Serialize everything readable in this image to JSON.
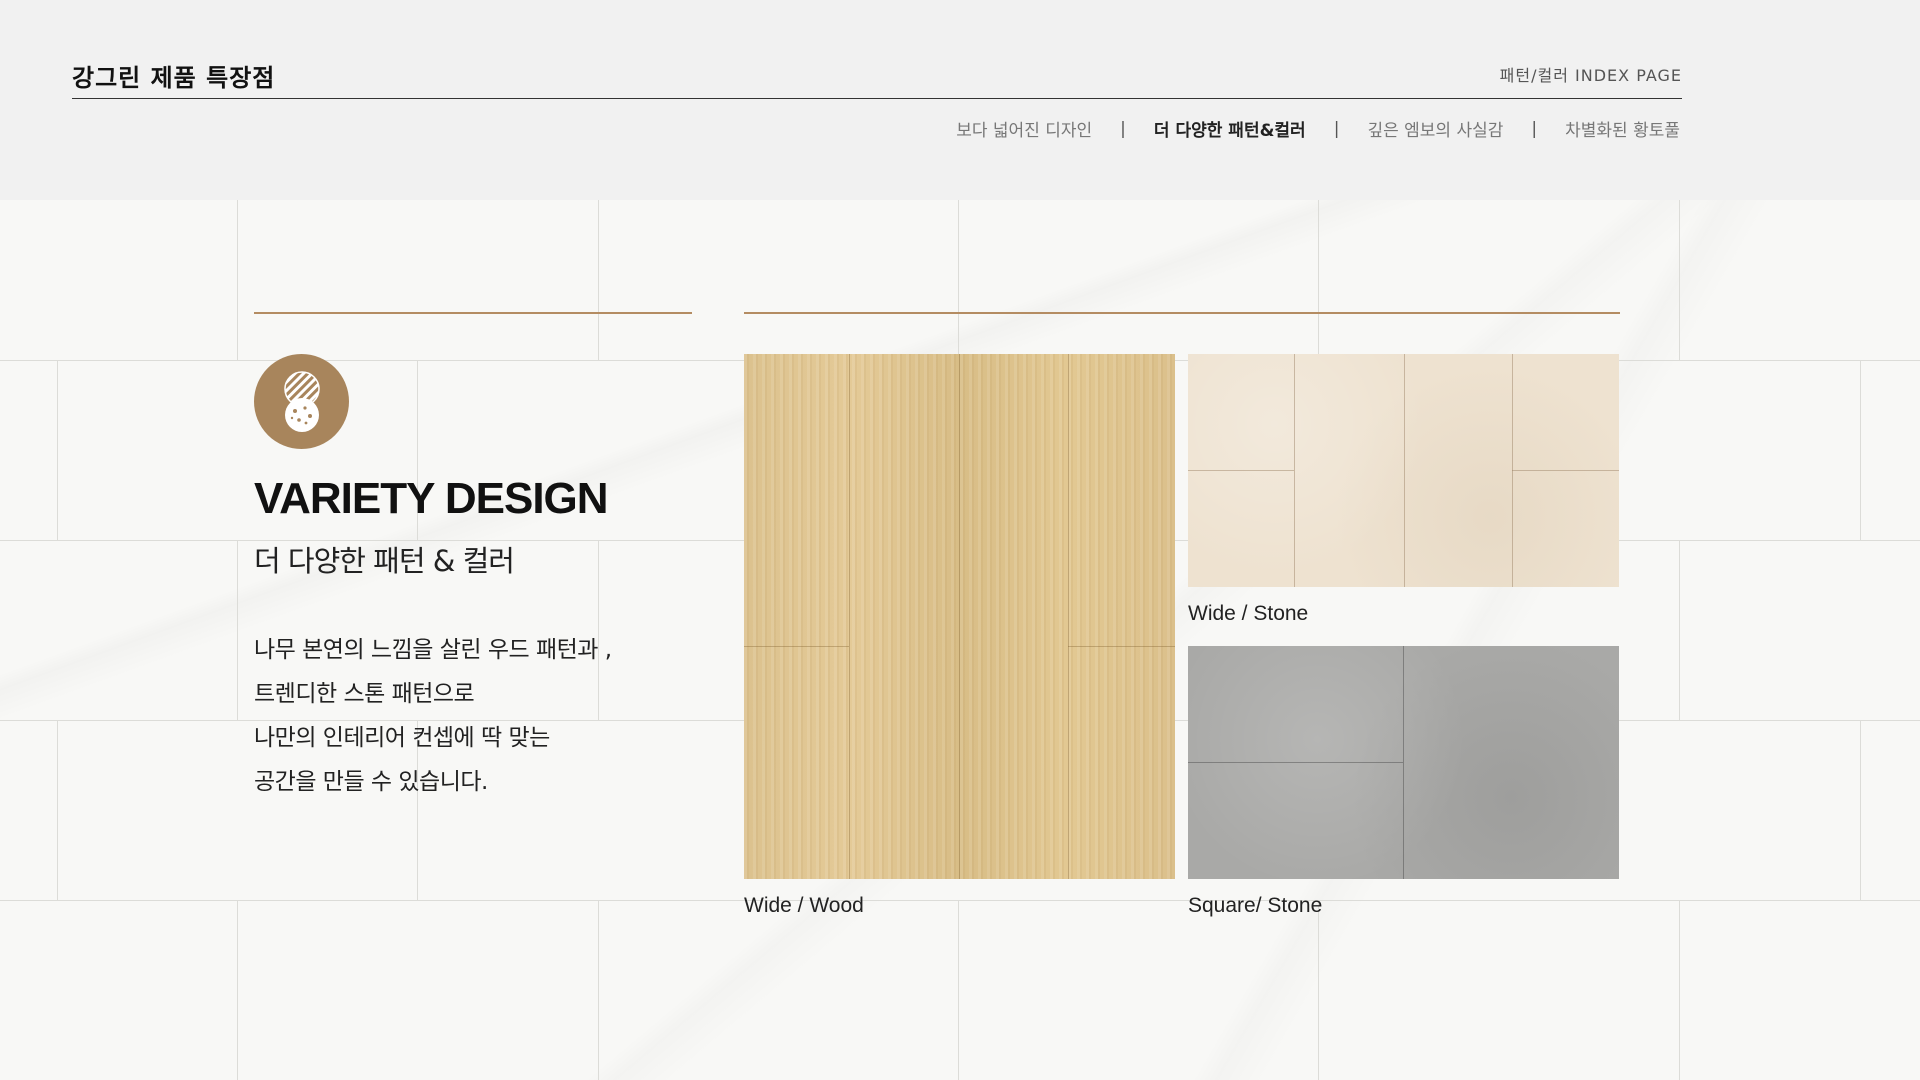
{
  "header": {
    "brand": "강그린 제품 특장점",
    "index_label": "패턴/컬러 INDEX PAGE",
    "nav": [
      {
        "label": "보다 넓어진 디자인",
        "active": false
      },
      {
        "label": "더 다양한 패턴&컬러",
        "active": true
      },
      {
        "label": "깊은 엠보의 사실감",
        "active": false
      },
      {
        "label": "차별화된 황토풀",
        "active": false
      }
    ],
    "separator": "|"
  },
  "intro": {
    "icon": "pattern-badge-icon",
    "headline": "VARIETY DESIGN",
    "subhead": "더 다양한 패턴 & 컬러",
    "description": [
      "나무 본연의 느낌을 살린 우드 패턴과 ,",
      "트렌디한 스톤 패턴으로",
      "나만의 인테리어 컨셉에 딱 맞는",
      "공간을 만들 수 있습니다."
    ]
  },
  "swatches": {
    "wood": {
      "caption": "Wide / Wood"
    },
    "stone_wide": {
      "caption": "Wide / Stone"
    },
    "stone_square": {
      "caption": "Square/ Stone"
    }
  },
  "colors": {
    "accent": "#b48c62",
    "badge": "#a8855c",
    "header_bg": "#f1f1f1"
  }
}
